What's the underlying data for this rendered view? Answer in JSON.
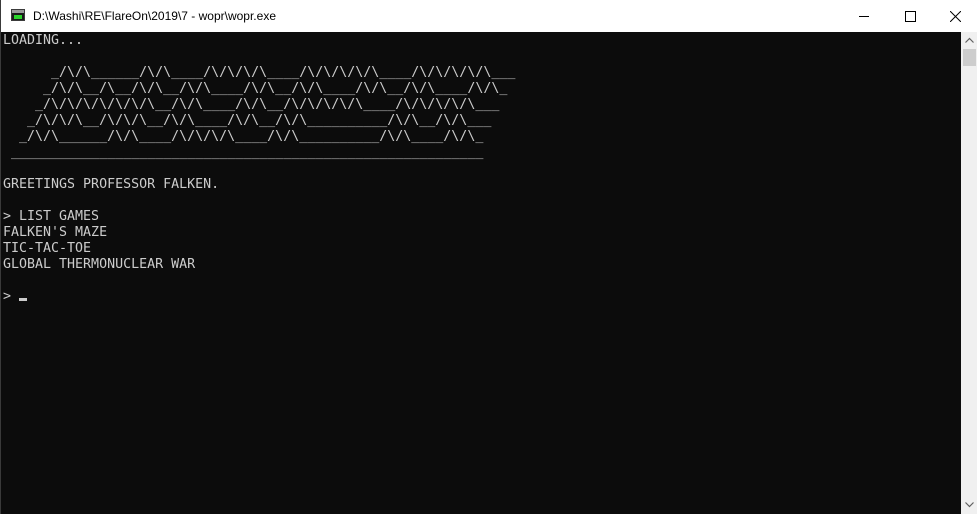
{
  "window": {
    "title": "D:\\Washi\\RE\\FlareOn\\2019\\7 - wopr\\wopr.exe",
    "icon": "console-app-icon",
    "controls": [
      "minimize-icon",
      "maximize-icon",
      "close-icon"
    ]
  },
  "console": {
    "lines": [
      "LOADING...",
      "",
      "      _/\\/\\______/\\/\\____/\\/\\/\\/\\____/\\/\\/\\/\\/\\____/\\/\\/\\/\\/\\___",
      "     _/\\/\\__/\\__/\\/\\__/\\/\\____/\\/\\__/\\/\\____/\\/\\__/\\/\\____/\\/\\_",
      "    _/\\/\\/\\/\\/\\/\\/\\__/\\/\\____/\\/\\__/\\/\\/\\/\\/\\____/\\/\\/\\/\\/\\___",
      "   _/\\/\\/\\__/\\/\\/\\__/\\/\\____/\\/\\__/\\/\\__________/\\/\\__/\\/\\___",
      "  _/\\/\\______/\\/\\____/\\/\\/\\/\\____/\\/\\__________/\\/\\____/\\/\\_",
      " ___________________________________________________________",
      "",
      "GREETINGS PROFESSOR FALKEN.",
      "",
      "> LIST GAMES",
      "FALKEN'S MAZE",
      "TIC-TAC-TOE",
      "GLOBAL THERMONUCLEAR WAR",
      "",
      "> "
    ],
    "text_color": "#cccccc",
    "background": "#0c0c0c"
  }
}
